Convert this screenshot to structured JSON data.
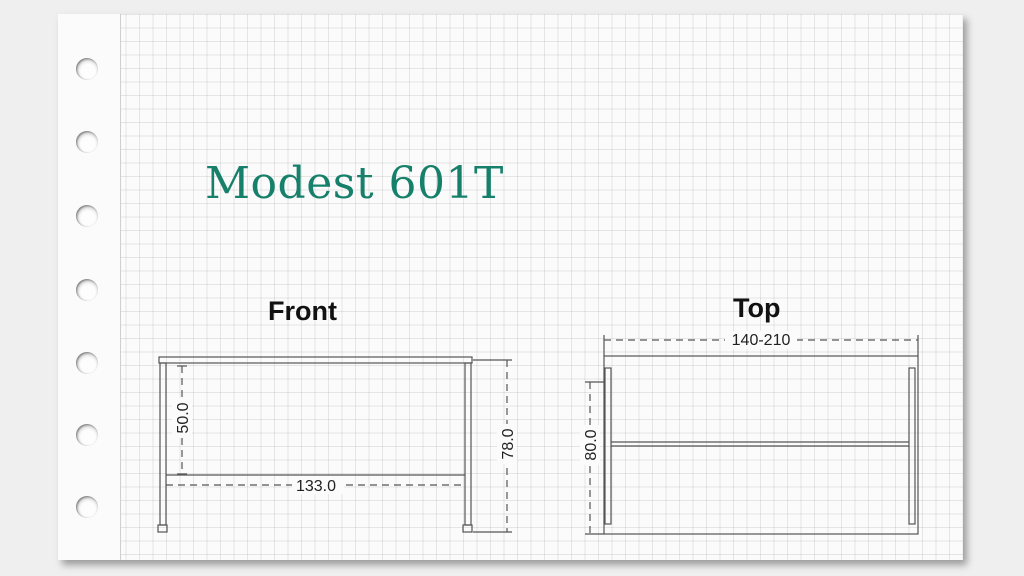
{
  "title": "Modest 601T",
  "front": {
    "label": "Front",
    "dims": {
      "width": "133.0",
      "leg_height": "50.0",
      "total_height": "78.0"
    }
  },
  "top": {
    "label": "Top",
    "dims": {
      "length": "140-210",
      "depth": "80.0"
    }
  },
  "colors": {
    "title": "#16806b",
    "line": "#555555",
    "grid": "#c8c8c8"
  }
}
